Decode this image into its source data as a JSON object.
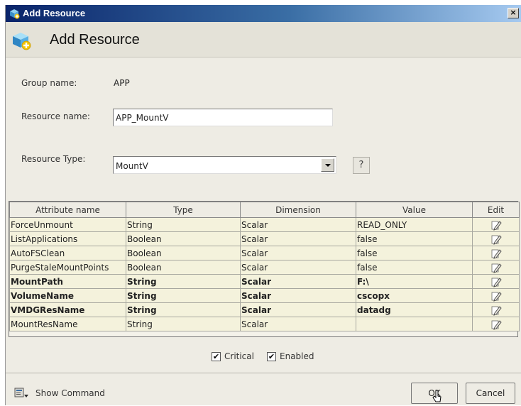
{
  "window": {
    "title": "Add Resource",
    "close_glyph": "×",
    "header_title": "Add Resource"
  },
  "form": {
    "group_label": "Group name:",
    "group_value": "APP",
    "resource_name_label": "Resource name:",
    "resource_name_value": "APP_MountV",
    "resource_type_label": "Resource Type:",
    "resource_type_value": "MountV",
    "help_glyph": "?"
  },
  "table": {
    "headers": [
      "Attribute name",
      "Type",
      "Dimension",
      "Value",
      "Edit"
    ],
    "rows": [
      {
        "name": "ForceUnmount",
        "type": "String",
        "dimension": "Scalar",
        "value": "READ_ONLY",
        "bold": false
      },
      {
        "name": "ListApplications",
        "type": "Boolean",
        "dimension": "Scalar",
        "value": "false",
        "bold": false
      },
      {
        "name": "AutoFSClean",
        "type": "Boolean",
        "dimension": "Scalar",
        "value": "false",
        "bold": false
      },
      {
        "name": "PurgeStaleMountPoints",
        "type": "Boolean",
        "dimension": "Scalar",
        "value": "false",
        "bold": false
      },
      {
        "name": "MountPath",
        "type": "String",
        "dimension": "Scalar",
        "value": "F:\\",
        "bold": true
      },
      {
        "name": "VolumeName",
        "type": "String",
        "dimension": "Scalar",
        "value": "cscopx",
        "bold": true
      },
      {
        "name": "VMDGResName",
        "type": "String",
        "dimension": "Scalar",
        "value": "datadg",
        "bold": true
      },
      {
        "name": "MountResName",
        "type": "String",
        "dimension": "Scalar",
        "value": "",
        "bold": false
      }
    ]
  },
  "options": {
    "critical_label": "Critical",
    "critical_checked": true,
    "enabled_label": "Enabled",
    "enabled_checked": true,
    "check_glyph": "✔"
  },
  "footer": {
    "show_command_label": "Show Command",
    "ok_label": "OK",
    "cancel_label": "Cancel"
  },
  "colors": {
    "titlebar_start": "#0a246a",
    "titlebar_end": "#a6caf0",
    "dialog_bg": "#eeece4",
    "table_row_bg": "#f4f2dc"
  },
  "icons": {
    "title": "add-resource-icon",
    "header": "add-resource-icon",
    "edit": "pencil-edit-icon",
    "show_command": "show-command-icon",
    "cursor": "mouse-cursor-icon"
  }
}
